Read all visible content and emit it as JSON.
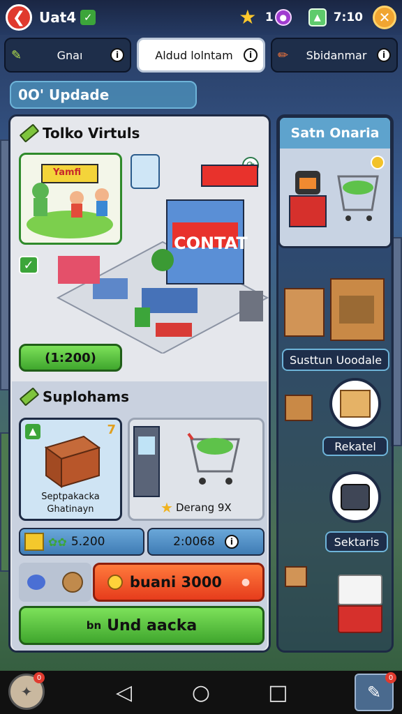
{
  "header": {
    "back_icon": "back-arrow-icon",
    "title": "Uat4",
    "stars": "1",
    "timer": "7:10"
  },
  "tabs": [
    {
      "label": "Gnaı",
      "icon": "pencil-icon"
    },
    {
      "label": "Aldud lolntam",
      "icon": ""
    },
    {
      "label": "Sbidanmar",
      "icon": "brush-icon"
    }
  ],
  "section_title": "0O' Updade",
  "shop": {
    "title": "Tolko Virtuls",
    "banner_text": "Yamfi",
    "store_sign": "CONTAT",
    "price_button": "(1:200)"
  },
  "supplies": {
    "title": "Suplohams",
    "card1_label_line1": "Septpakacka",
    "card1_label_line2": "Ghatinayn",
    "card2_label": "Derang 9X",
    "stat_left": "5.200",
    "stat_right": "2:0068",
    "buy_button": "buani 3000",
    "upgrade_button": "Und aacka",
    "upgrade_prefix": "bn"
  },
  "side": {
    "title": "Satn Onaria",
    "upgrade_label": "Susttun Uoodale",
    "pill1": "Rekatel",
    "pill2": "Sektaris"
  },
  "colors": {
    "accent_green": "#3fa62d",
    "accent_red": "#e63c1c",
    "accent_blue": "#5ea3cd",
    "gold": "#ffc82c"
  }
}
